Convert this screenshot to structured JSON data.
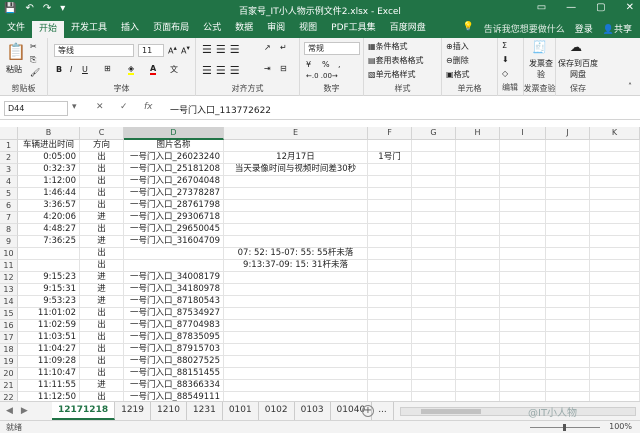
{
  "titlebar": {
    "title": "百家号_IT小人物示例文件2.xlsx - Excel",
    "qat": [
      "💾",
      "↶",
      "↷",
      "▾"
    ],
    "winbtns": [
      "▭",
      "—",
      "▢",
      "✕"
    ]
  },
  "tabs": [
    "文件",
    "开始",
    "开发工具",
    "插入",
    "页面布局",
    "公式",
    "数据",
    "审阅",
    "视图",
    "PDF工具集",
    "百度网盘"
  ],
  "active_tab": "开始",
  "tell_me": "告诉我您想要做什么",
  "login": "登录",
  "share": "共享",
  "ribbon": {
    "paste": "粘贴",
    "clipboard": "剪贴板",
    "font_name": "等线",
    "font_size": "11",
    "font_group": "字体",
    "bold": "B",
    "italic": "I",
    "underline": "U",
    "align_group": "对齐方式",
    "number_format": "常规",
    "number_group": "数字",
    "percent": "%",
    "comma": ",",
    "cond_format": "条件格式",
    "table_format": "套用表格格式",
    "cell_style": "单元格样式",
    "style_group": "样式",
    "insert": "插入",
    "delete": "删除",
    "format": "格式",
    "cells_group": "单元格",
    "edit_group": "编辑",
    "invoice_check": "发票查验",
    "invoice_group": "发票查验",
    "save_baidu": "保存到百度网盘",
    "save_group": "保存"
  },
  "formula": {
    "namebox": "D44",
    "fx": "fx",
    "content": "一号门入口_113772622"
  },
  "columns": [
    "B",
    "C",
    "D",
    "E",
    "F",
    "G",
    "H",
    "I",
    "J",
    "K"
  ],
  "selected_column": "D",
  "rows": [
    {
      "n": "1",
      "b": "车辆进出时间",
      "c": "方向",
      "d": "图片名称",
      "e": "",
      "f": ""
    },
    {
      "n": "2",
      "b": "0:05:00",
      "c": "出",
      "d": "一号门入口_26023240",
      "e": "12月17日",
      "f": "1号门"
    },
    {
      "n": "3",
      "b": "0:32:37",
      "c": "出",
      "d": "一号门入口_25181208",
      "e": "当天录像时间与视频时间差30秒",
      "f": ""
    },
    {
      "n": "4",
      "b": "1:12:00",
      "c": "出",
      "d": "一号门入口_26704048",
      "e": "",
      "f": ""
    },
    {
      "n": "5",
      "b": "1:46:44",
      "c": "出",
      "d": "一号门入口_27378287",
      "e": "",
      "f": ""
    },
    {
      "n": "6",
      "b": "3:36:57",
      "c": "出",
      "d": "一号门入口_28761798",
      "e": "",
      "f": ""
    },
    {
      "n": "7",
      "b": "4:20:06",
      "c": "进",
      "d": "一号门入口_29306718",
      "e": "",
      "f": ""
    },
    {
      "n": "8",
      "b": "4:48:27",
      "c": "出",
      "d": "一号门入口_29650045",
      "e": "",
      "f": ""
    },
    {
      "n": "9",
      "b": "7:36:25",
      "c": "进",
      "d": "一号门入口_31604709",
      "e": "",
      "f": ""
    },
    {
      "n": "10",
      "b": "",
      "c": "出",
      "d": "",
      "e": "07:  52:  15-07:  55:  55杆未落",
      "f": ""
    },
    {
      "n": "11",
      "b": "",
      "c": "出",
      "d": "",
      "e": "9:13:37-09:  15:  31杆未落",
      "f": ""
    },
    {
      "n": "12",
      "b": "9:15:23",
      "c": "进",
      "d": "一号门入口_34008179",
      "e": "",
      "f": ""
    },
    {
      "n": "13",
      "b": "9:15:31",
      "c": "进",
      "d": "一号门入口_34180978",
      "e": "",
      "f": ""
    },
    {
      "n": "14",
      "b": "9:53:23",
      "c": "进",
      "d": "一号门入口_87180543",
      "e": "",
      "f": ""
    },
    {
      "n": "15",
      "b": "11:01:02",
      "c": "出",
      "d": "一号门入口_87534927",
      "e": "",
      "f": ""
    },
    {
      "n": "16",
      "b": "11:02:59",
      "c": "出",
      "d": "一号门入口_87704983",
      "e": "",
      "f": ""
    },
    {
      "n": "17",
      "b": "11:03:51",
      "c": "出",
      "d": "一号门入口_87835095",
      "e": "",
      "f": ""
    },
    {
      "n": "18",
      "b": "11:04:27",
      "c": "出",
      "d": "一号门入口_87915703",
      "e": "",
      "f": ""
    },
    {
      "n": "19",
      "b": "11:09:28",
      "c": "出",
      "d": "一号门入口_88027525",
      "e": "",
      "f": ""
    },
    {
      "n": "20",
      "b": "11:10:47",
      "c": "出",
      "d": "一号门入口_88151455",
      "e": "",
      "f": ""
    },
    {
      "n": "21",
      "b": "11:11:55",
      "c": "进",
      "d": "一号门入口_88366334",
      "e": "",
      "f": ""
    },
    {
      "n": "22",
      "b": "11:12:50",
      "c": "出",
      "d": "一号门入口_88549111",
      "e": "",
      "f": ""
    }
  ],
  "sheets": [
    "12171218",
    "1219",
    "1210",
    "1231",
    "0101",
    "0102",
    "0103",
    "01040"
  ],
  "active_sheet": "12171218",
  "sheet_more": "...",
  "add_sheet": "+",
  "status": "就绪",
  "zoom": "100%",
  "watermark": "@IT小人物"
}
